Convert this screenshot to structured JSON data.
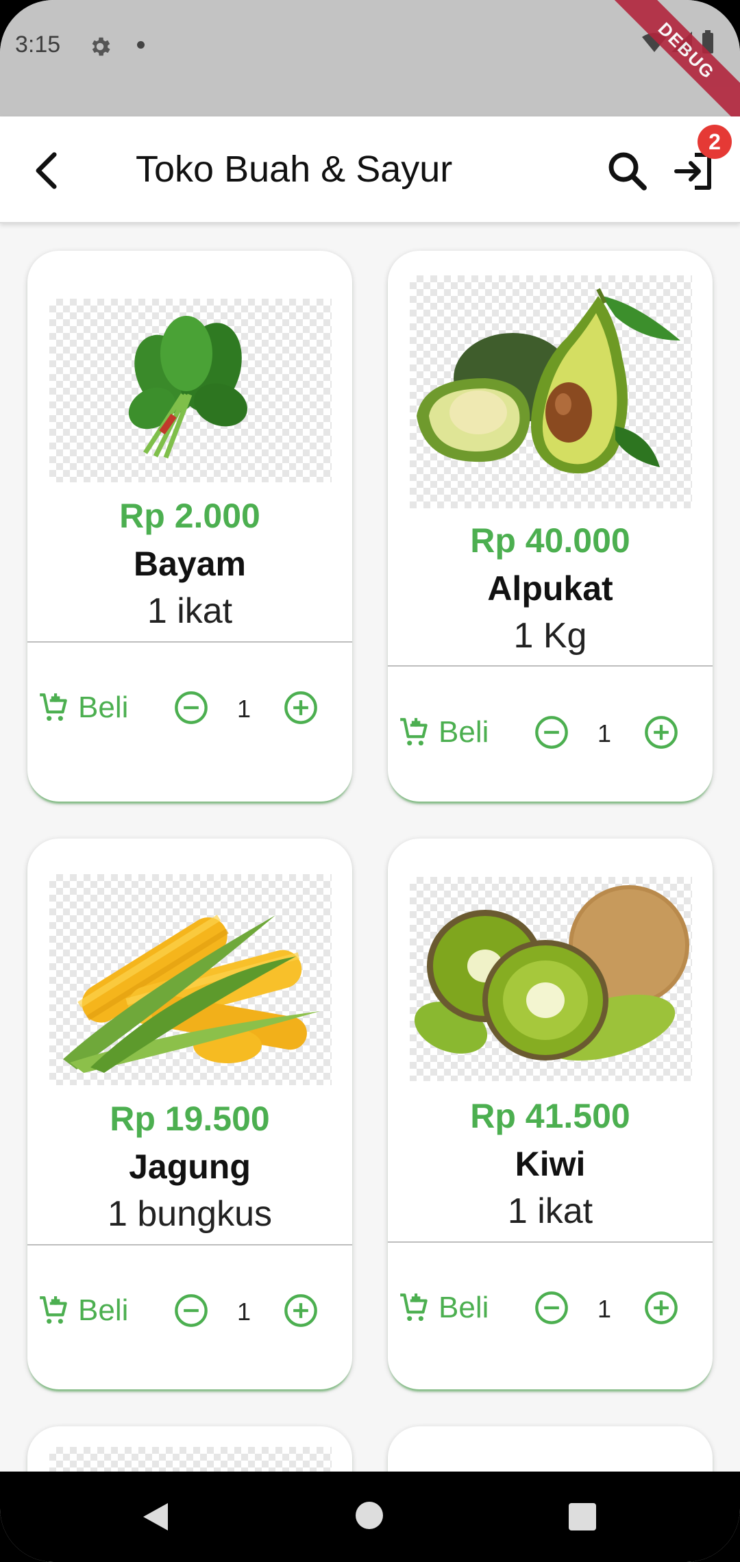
{
  "status_bar": {
    "time": "3:15",
    "debug_label": "DEBUG"
  },
  "app_bar": {
    "title": "Toko Buah & Sayur",
    "cart_badge": "2"
  },
  "colors": {
    "accent": "#4caf50",
    "badge": "#e53935",
    "debug": "#b2263d"
  },
  "products": [
    {
      "price": "Rp 2.000",
      "name": "Bayam",
      "unit": "1 ikat",
      "buy_label": "Beli",
      "quantity": "1",
      "image": "spinach"
    },
    {
      "price": "Rp 40.000",
      "name": "Alpukat",
      "unit": "1 Kg",
      "buy_label": "Beli",
      "quantity": "1",
      "image": "avocado"
    },
    {
      "price": "Rp 19.500",
      "name": "Jagung",
      "unit": "1 bungkus",
      "buy_label": "Beli",
      "quantity": "1",
      "image": "corn"
    },
    {
      "price": "Rp 41.500",
      "name": "Kiwi",
      "unit": "1 ikat",
      "buy_label": "Beli",
      "quantity": "1",
      "image": "kiwi"
    }
  ],
  "icons": {
    "back": "arrow-back-icon",
    "search": "search-icon",
    "login": "login-icon",
    "cart": "add-cart-icon",
    "minus": "minus-circle-icon",
    "plus": "plus-circle-icon"
  }
}
